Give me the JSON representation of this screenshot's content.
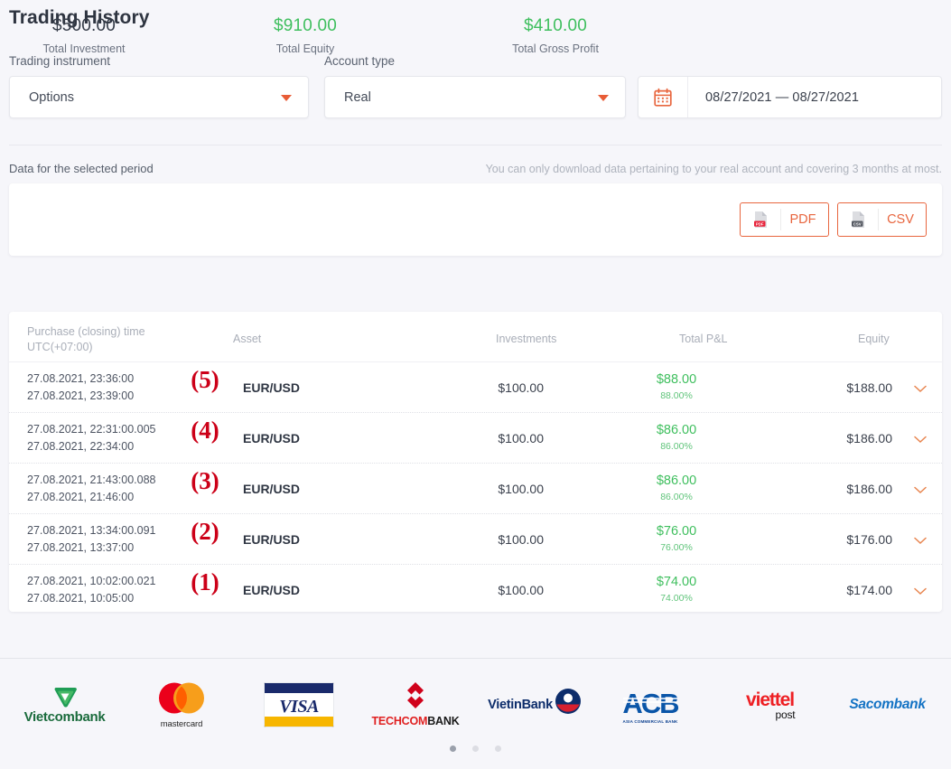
{
  "header": {
    "title": "Trading History"
  },
  "filters": {
    "instrument": {
      "label": "Trading instrument",
      "value": "Options"
    },
    "account": {
      "label": "Account type",
      "value": "Real"
    },
    "date_range": {
      "value": "08/27/2021 — 08/27/2021",
      "icon": "calendar-icon"
    }
  },
  "summary": {
    "period_label": "Data for the selected period",
    "note": "You can only download data pertaining to your real account and covering 3 months at most.",
    "stats": [
      {
        "value": "$500.00",
        "caption": "Total Investment",
        "color": "#343b47"
      },
      {
        "value": "$910.00",
        "caption": "Total Equity",
        "color": "#3fbf5e"
      },
      {
        "value": "$410.00",
        "caption": "Total Gross Profit",
        "color": "#3fbf5e"
      }
    ],
    "downloads": [
      {
        "label": "PDF",
        "icon": "pdf-file-icon"
      },
      {
        "label": "CSV",
        "icon": "csv-file-icon"
      }
    ]
  },
  "table": {
    "columns": {
      "time_line1": "Purchase (closing) time",
      "time_line2": "UTC(+07:00)",
      "asset": "Asset",
      "investments": "Investments",
      "pl": "Total P&L",
      "equity": "Equity"
    },
    "rows": [
      {
        "marker": "(5)",
        "open_time": "27.08.2021, 23:36:00",
        "close_time": "27.08.2021, 23:39:00",
        "asset": "EUR/USD",
        "investment": "$100.00",
        "pl": "$88.00",
        "pl_pct": "88.00%",
        "equity": "$188.00"
      },
      {
        "marker": "(4)",
        "open_time": "27.08.2021, 22:31:00.005",
        "close_time": "27.08.2021, 22:34:00",
        "asset": "EUR/USD",
        "investment": "$100.00",
        "pl": "$86.00",
        "pl_pct": "86.00%",
        "equity": "$186.00"
      },
      {
        "marker": "(3)",
        "open_time": "27.08.2021, 21:43:00.088",
        "close_time": "27.08.2021, 21:46:00",
        "asset": "EUR/USD",
        "investment": "$100.00",
        "pl": "$86.00",
        "pl_pct": "86.00%",
        "equity": "$186.00"
      },
      {
        "marker": "(2)",
        "open_time": "27.08.2021, 13:34:00.091",
        "close_time": "27.08.2021, 13:37:00",
        "asset": "EUR/USD",
        "investment": "$100.00",
        "pl": "$76.00",
        "pl_pct": "76.00%",
        "equity": "$176.00"
      },
      {
        "marker": "(1)",
        "open_time": "27.08.2021, 10:02:00.021",
        "close_time": "27.08.2021, 10:05:00",
        "asset": "EUR/USD",
        "investment": "$100.00",
        "pl": "$74.00",
        "pl_pct": "74.00%",
        "equity": "$174.00"
      }
    ]
  },
  "footer": {
    "logos": [
      {
        "name": "vietcombank-logo",
        "text": "Vietcombank"
      },
      {
        "name": "mastercard-logo",
        "text": "mastercard"
      },
      {
        "name": "visa-logo",
        "text": "VISA"
      },
      {
        "name": "techcombank-logo",
        "text": "TECHCOMBANK",
        "text1": "TECHCOM",
        "text2": "BANK"
      },
      {
        "name": "vietinbank-logo",
        "text": "VietinBank"
      },
      {
        "name": "acb-logo",
        "text": "ACB",
        "sub": "ASIA COMMERCIAL BANK"
      },
      {
        "name": "viettel-post-logo",
        "text": "viettel",
        "sub": "post"
      },
      {
        "name": "sacombank-logo",
        "text": "Sacombank"
      }
    ],
    "carousel_dots": 3,
    "active_dot": 0
  },
  "colors": {
    "accent": "#e8663f",
    "positive": "#3fbf5e",
    "marker": "#cc0018",
    "page_bg": "#f6f6fa"
  }
}
